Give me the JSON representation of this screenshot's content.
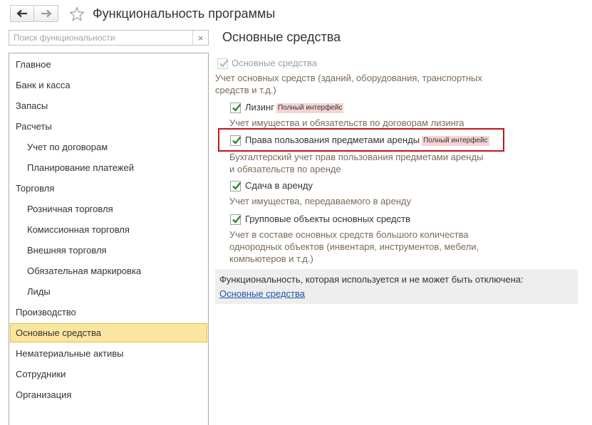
{
  "window": {
    "title": "Функциональность программы",
    "back_icon": "arrow-left-icon",
    "forward_icon": "arrow-right-icon",
    "favorite_icon": "star-icon"
  },
  "search": {
    "placeholder": "Поиск функциональности",
    "value": "",
    "clear_symbol": "×"
  },
  "sections": [
    {
      "label": "Главное"
    },
    {
      "label": "Банк и касса"
    },
    {
      "label": "Запасы"
    },
    {
      "label": "Расчеты"
    },
    {
      "label": "Учет по договорам"
    },
    {
      "label": "Планирование платежей"
    },
    {
      "label": "Торговля"
    },
    {
      "label": "Розничная торговля"
    },
    {
      "label": "Комиссионная торговля"
    },
    {
      "label": "Внешняя торговля"
    },
    {
      "label": "Обязательная маркировка"
    },
    {
      "label": "Лиды"
    },
    {
      "label": "Производство"
    },
    {
      "label": "Основные средства",
      "selected": true
    },
    {
      "label": "Нематериальные активы"
    },
    {
      "label": "Сотрудники"
    },
    {
      "label": "Организация"
    }
  ],
  "main": {
    "title": "Основные средства",
    "master": {
      "label": "Основные средства",
      "checked": true,
      "enabled": false,
      "description": "Учет основных средств (зданий, оборудования, транспортных\nсредств и т.д.)"
    },
    "options": [
      {
        "label": "Лизинг",
        "badge": "Полный интерфейс",
        "checked": true,
        "description": "Учет имущества и обязательств  по договорам лизинга"
      },
      {
        "label": "Права пользования предметами аренды",
        "badge": "Полный интерфейс",
        "checked": true,
        "highlighted": true,
        "description": "Бухгалтерский учет прав пользования предметами аренды\nи обязательств по аренде"
      },
      {
        "label": "Сдача в аренду",
        "checked": true,
        "description": "Учет имущества, передаваемого в аренду"
      },
      {
        "label": "Групповые объекты основных средств",
        "checked": true,
        "description": "Учет в составе основных средств большого количества\nоднородных объектов (инвентаря, инструментов, мебели,\nкомпьютеров и т.д.)"
      }
    ],
    "always_on": {
      "text": "Функциональность, которая используется и не может быть отключена:",
      "link": "Основные средства"
    }
  },
  "colors": {
    "accent_selected": "#fbe6a0",
    "badge_bg": "#f6d3d3",
    "highlight_frame": "#c0161d",
    "checkmark": "#2e8b2e",
    "link": "#1a57a8"
  }
}
